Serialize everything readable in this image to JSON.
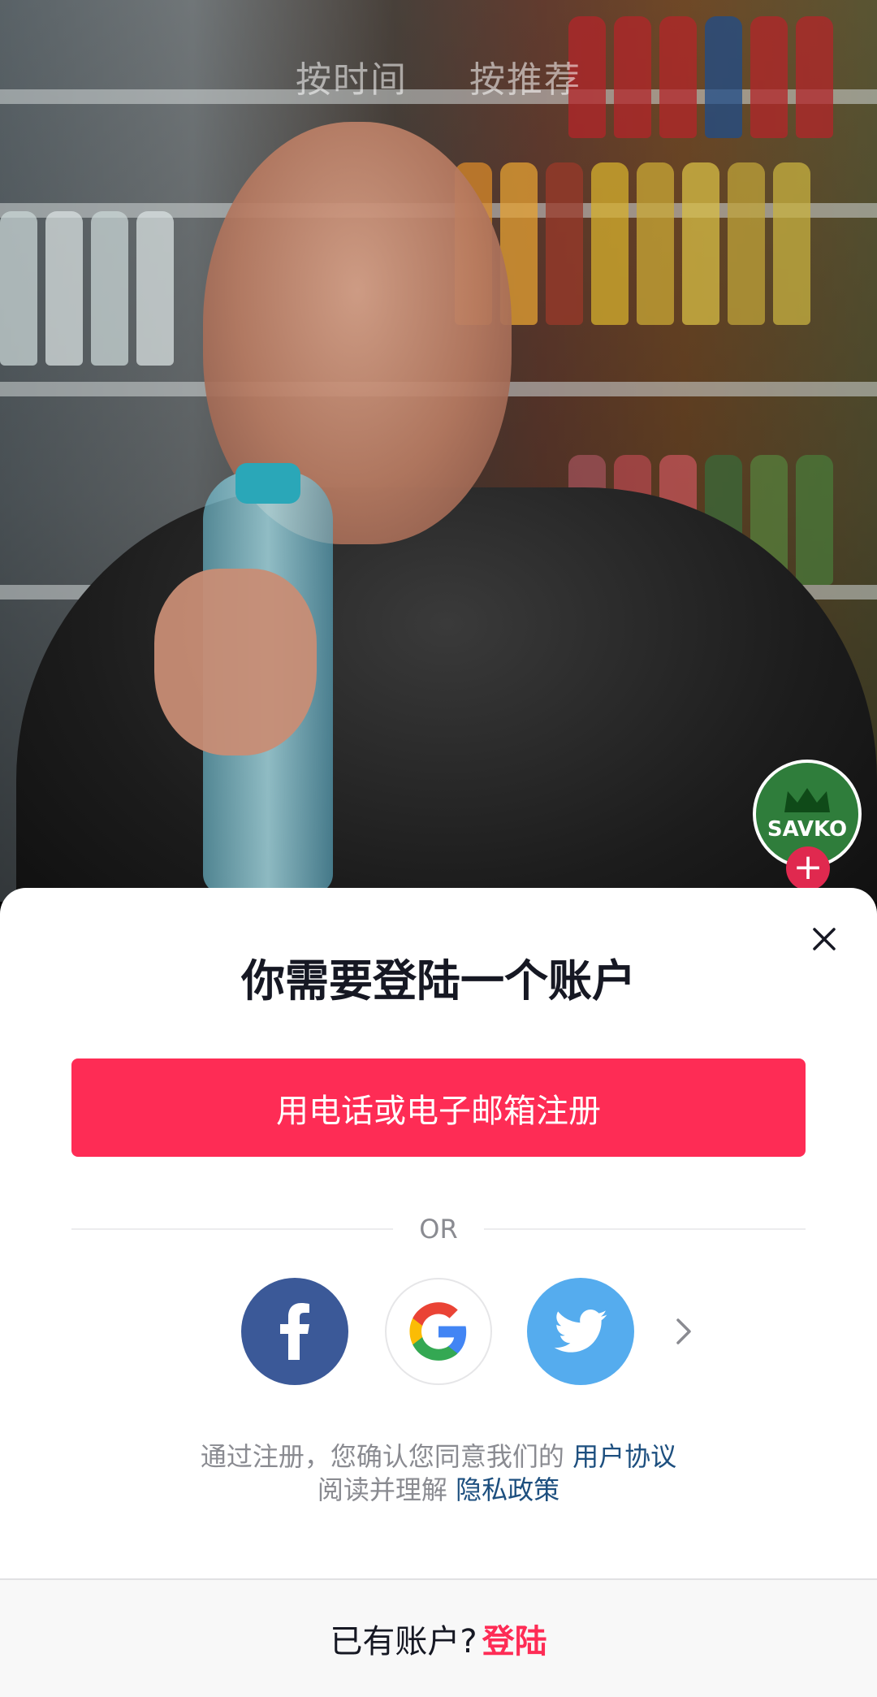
{
  "video": {
    "tabs": [
      "按时间",
      "按推荐"
    ],
    "avatar_text": "SAVKO",
    "follow_icon": "plus-icon"
  },
  "sheet": {
    "title": "你需要登陆一个账户",
    "close_icon": "close-icon",
    "signup_button": "用电话或电子邮箱注册",
    "divider_text": "OR",
    "social_buttons": [
      {
        "icon": "facebook-icon",
        "color": "#3b5998"
      },
      {
        "icon": "google-icon",
        "color": "#ffffff"
      },
      {
        "icon": "twitter-icon",
        "color": "#55acee"
      }
    ],
    "more_icon": "chevron-right-icon",
    "terms": {
      "line1_prefix": "通过注册，您确认您同意我们的",
      "line1_link": "用户协议",
      "line2_prefix": "阅读并理解",
      "line2_link": "隐私政策"
    },
    "login_bar": {
      "prompt": "已有账户?",
      "link": "登陆"
    }
  },
  "colors": {
    "accent": "#fe2c55",
    "link": "#1d4f7f",
    "text": "#161823",
    "muted": "#8a8b91"
  }
}
